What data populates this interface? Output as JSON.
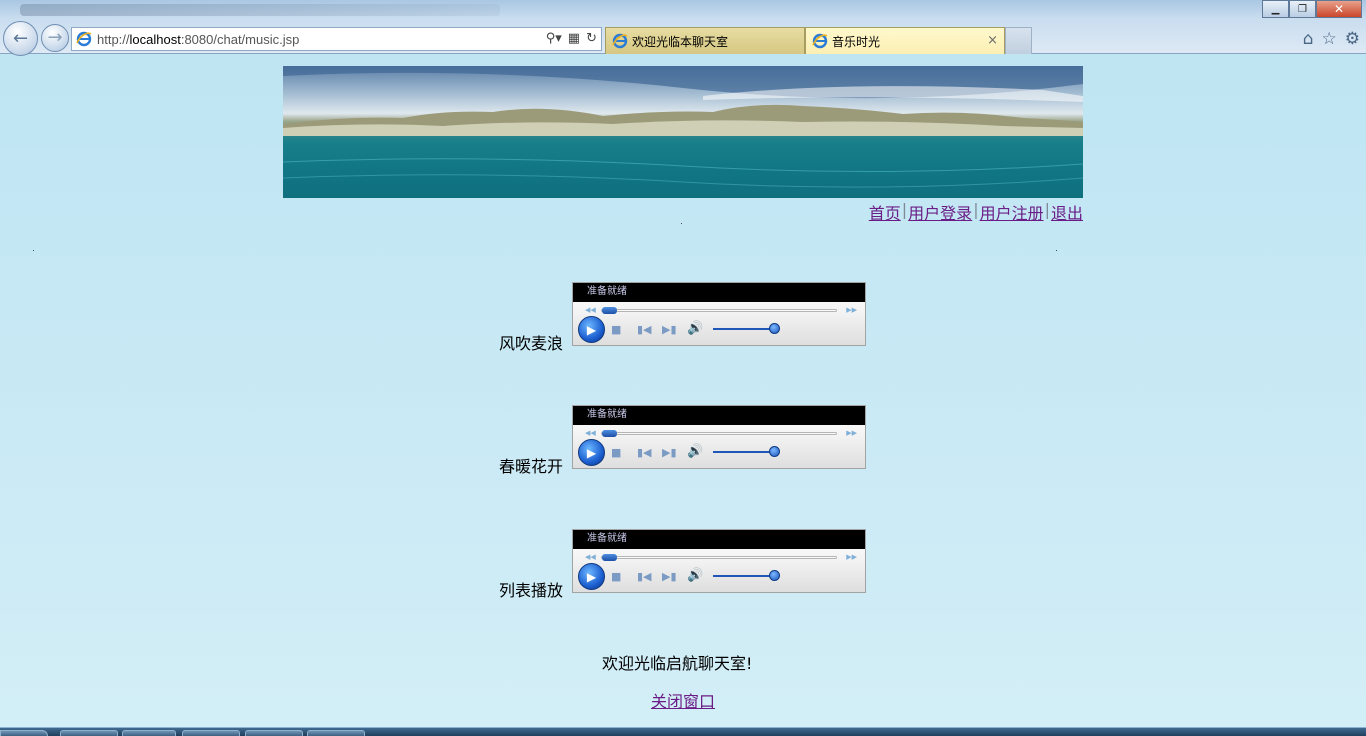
{
  "browser": {
    "url_prefix": "http://",
    "url_host": "localhost",
    "url_path": ":8080/chat/music.jsp",
    "tabs": [
      {
        "label": "欢迎光临本聊天室",
        "active": false
      },
      {
        "label": "音乐时光",
        "active": true
      }
    ],
    "tab_close_glyph": "×",
    "window_controls": {
      "minimize": "▁",
      "maximize": "❐",
      "close": "✕"
    },
    "icons": [
      "back-arrow-icon",
      "forward-arrow-icon",
      "ie-logo-icon",
      "search-icon",
      "compatibility-icon",
      "refresh-icon",
      "home-icon",
      "favorites-star-icon",
      "tools-gear-icon"
    ]
  },
  "nav": {
    "home": "首页",
    "login": "用户登录",
    "register": "用户注册",
    "logout": "退出",
    "separator": "|"
  },
  "songs": [
    {
      "title": "风吹麦浪",
      "status": "准备就绪"
    },
    {
      "title": "春暖花开",
      "status": "准备就绪"
    },
    {
      "title": "列表播放",
      "status": "准备就绪"
    }
  ],
  "footer": {
    "welcome": "欢迎光临启航聊天室!",
    "close_window": "关闭窗口"
  },
  "colors": {
    "page_bg": "#c9eaf5",
    "link_visited": "#6a1d86",
    "player_status_bg": "#000000",
    "tab_active_bg": "#fff8cc"
  }
}
